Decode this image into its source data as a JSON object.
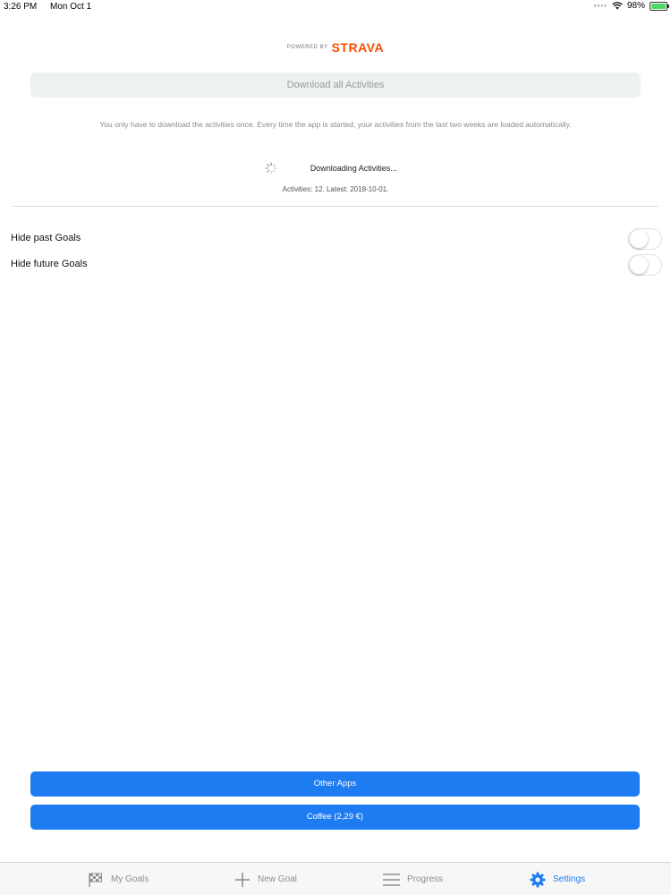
{
  "status_bar": {
    "time": "3:26 PM",
    "date": "Mon Oct 1",
    "battery": "98%",
    "battery_level": 0.98
  },
  "branding": {
    "powered_by": "POWERED BY",
    "brand": "STRAVA",
    "brand_color": "#fc4c02"
  },
  "download": {
    "button_label": "Download all Activities",
    "info": "You only have to download the activities once. Every time the app is started, your activities from the last two weeks are loaded automatically.",
    "status": "Downloading Activities...",
    "stats": "Activities: 12. Latest: 2018-10-01."
  },
  "settings": {
    "toggles": [
      {
        "label": "Hide past Goals",
        "on": false
      },
      {
        "label": "Hide future Goals",
        "on": false
      }
    ]
  },
  "buttons": {
    "other_apps": "Other Apps",
    "coffee": "Coffee (2,29 €)",
    "accent_color": "#1e7cf2"
  },
  "tab_bar": {
    "tabs": [
      {
        "label": "My Goals",
        "icon": "checkered-flag-icon",
        "active": false
      },
      {
        "label": "New Goal",
        "icon": "plus-icon",
        "active": false
      },
      {
        "label": "Progress",
        "icon": "list-icon",
        "active": false
      },
      {
        "label": "Settings",
        "icon": "gear-icon",
        "active": true
      }
    ]
  }
}
